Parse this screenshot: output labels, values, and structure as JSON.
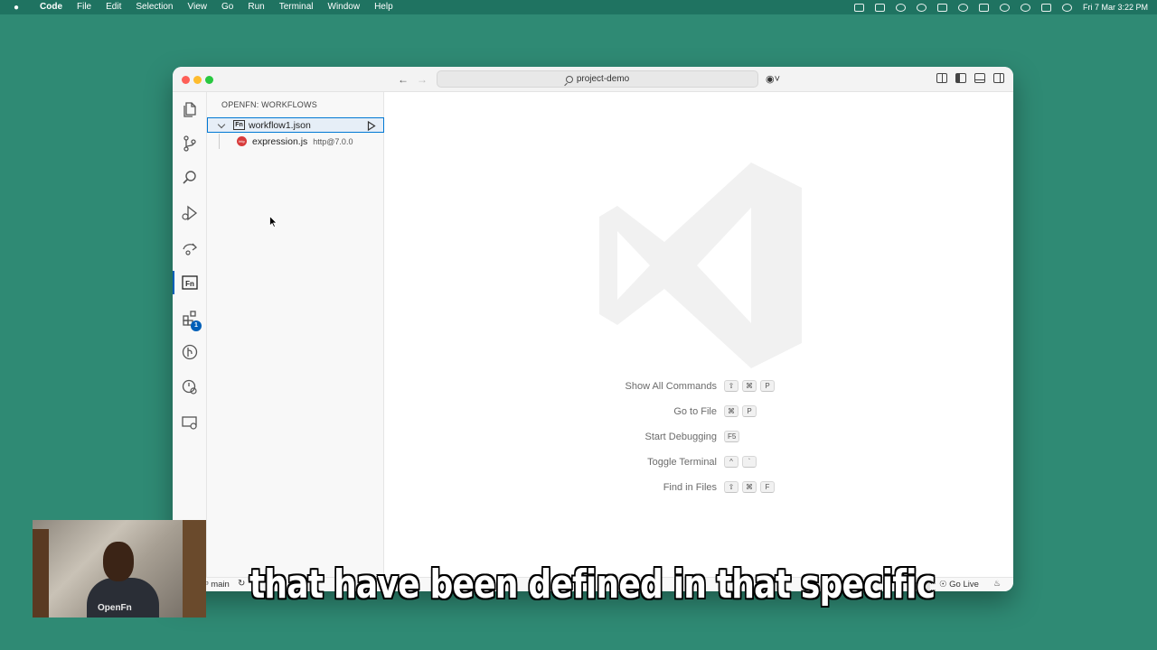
{
  "menubar": {
    "app_name": "Code",
    "items": [
      "File",
      "Edit",
      "Selection",
      "View",
      "Go",
      "Run",
      "Terminal",
      "Window",
      "Help"
    ],
    "clock": "Fri 7 Mar  3:22 PM"
  },
  "window": {
    "search_label": "project-demo"
  },
  "sidebar": {
    "title": "OPENFN: WORKFLOWS",
    "workflow": {
      "label": "workflow1.json",
      "icon_text": "Fn"
    },
    "expression": {
      "label": "expression.js",
      "description": "http@7.0.0",
      "icon_text": "http"
    }
  },
  "activitybar": {
    "openfn_label": "Fn",
    "extensions_badge": "1"
  },
  "editor": {
    "shortcuts": [
      {
        "label": "Show All Commands",
        "keys": [
          "⇧",
          "⌘",
          "P"
        ]
      },
      {
        "label": "Go to File",
        "keys": [
          "⌘",
          "P"
        ]
      },
      {
        "label": "Start Debugging",
        "keys": [
          "F5"
        ]
      },
      {
        "label": "Toggle Terminal",
        "keys": [
          "^",
          "`"
        ]
      },
      {
        "label": "Find in Files",
        "keys": [
          "⇧",
          "⌘",
          "F"
        ]
      }
    ]
  },
  "statusbar": {
    "branch": "main",
    "go_live": "Go Live"
  },
  "webcam": {
    "shirt_text": "OpenFn"
  },
  "caption": {
    "text": "that have been defined in that specific"
  },
  "colors": {
    "desktop": "#2f8a74",
    "accent": "#005fb8",
    "selection_border": "#0078d4"
  }
}
